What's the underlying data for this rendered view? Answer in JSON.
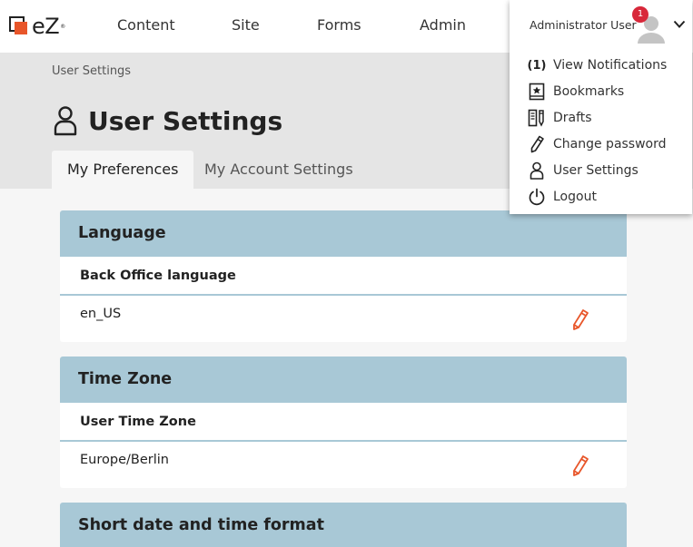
{
  "brand": {
    "logo_text": "eZ",
    "logo_mark": "®"
  },
  "nav": {
    "items": [
      {
        "label": "Content"
      },
      {
        "label": "Site"
      },
      {
        "label": "Forms"
      },
      {
        "label": "Admin"
      }
    ]
  },
  "user_menu": {
    "user_name": "Administrator User",
    "notification_count": "1",
    "items": [
      {
        "label": "View Notifications",
        "icon": "(1)"
      },
      {
        "label": "Bookmarks",
        "icon": "bookmark-icon"
      },
      {
        "label": "Drafts",
        "icon": "drafts-icon"
      },
      {
        "label": "Change password",
        "icon": "pencil-icon"
      },
      {
        "label": "User Settings",
        "icon": "user-icon"
      },
      {
        "label": "Logout",
        "icon": "power-icon"
      }
    ]
  },
  "header": {
    "breadcrumb": "User Settings",
    "title": "User Settings",
    "tabs": [
      {
        "label": "My Preferences",
        "active": true
      },
      {
        "label": "My Account Settings",
        "active": false
      }
    ]
  },
  "sections": [
    {
      "title": "Language",
      "label": "Back Office language",
      "value": "en_US"
    },
    {
      "title": "Time Zone",
      "label": "User Time Zone",
      "value": "Europe/Berlin"
    },
    {
      "title": "Short date and time format"
    }
  ],
  "colors": {
    "accent": "#e8562a",
    "card_header": "#a8c8d6",
    "badge": "#d8283a",
    "header_band": "#e5e5e5"
  }
}
